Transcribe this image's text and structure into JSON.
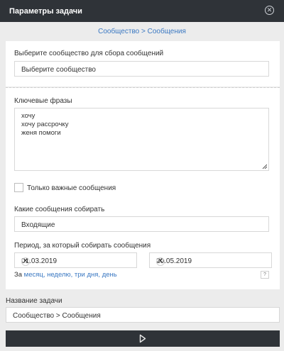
{
  "window": {
    "title": "Параметры задачи",
    "close_icon": "close-circle-icon"
  },
  "breadcrumb": "Сообщество > Сообщения",
  "community": {
    "label": "Выберите сообщество для сбора сообщений",
    "value": "Выберите сообщество"
  },
  "keywords": {
    "label": "Ключевые фразы",
    "lines": [
      "хочу",
      "хочу рассрочку",
      "женя помоги"
    ]
  },
  "important_only": {
    "label": "Только важные сообщения",
    "checked": false
  },
  "message_type": {
    "label": "Какие сообщения собирать",
    "value": "Входящие"
  },
  "period": {
    "label": "Период, за который собирать сообщения",
    "from": "01.03.2019",
    "to": "20.05.2019",
    "quick_prefix": "За",
    "quick_links": [
      "месяц,",
      "неделю,",
      "три дня,",
      "день"
    ],
    "help": "?"
  },
  "task_name": {
    "label": "Название задачи",
    "value": "Сообщество > Сообщения"
  },
  "run_button": {
    "icon": "play-icon"
  },
  "colors": {
    "titlebar": "#2f3338",
    "link": "#3a78c2",
    "background": "#ececec"
  }
}
